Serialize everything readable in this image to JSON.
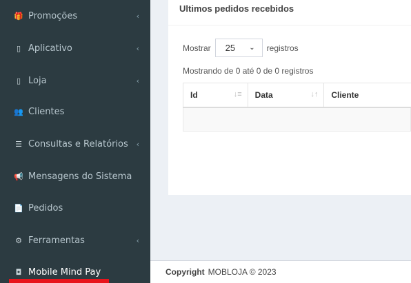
{
  "sidebar": {
    "items": [
      {
        "label": "Promoções",
        "icon": "gift-icon",
        "glyph": "🎁",
        "chevron": "‹"
      },
      {
        "label": "Aplicativo",
        "icon": "mobile-icon",
        "glyph": "▯",
        "chevron": "‹"
      },
      {
        "label": "Loja",
        "icon": "store-icon",
        "glyph": "▯",
        "chevron": "‹"
      },
      {
        "label": "Clientes",
        "icon": "users-icon",
        "glyph": "👥",
        "chevron": ""
      },
      {
        "label": "Consultas e Relatórios",
        "icon": "list-icon",
        "glyph": "☰",
        "chevron": "‹"
      },
      {
        "label": "Mensagens do Sistema",
        "icon": "bullhorn-icon",
        "glyph": "📢",
        "chevron": ""
      },
      {
        "label": "Pedidos",
        "icon": "file-icon",
        "glyph": "📄",
        "chevron": ""
      },
      {
        "label": "Ferramentas",
        "icon": "cogs-icon",
        "glyph": "⚙",
        "chevron": "‹"
      },
      {
        "label": "Mobile Mind Pay",
        "icon": "money-icon",
        "glyph": "◘",
        "chevron": ""
      }
    ],
    "active_accent": "#e8141c"
  },
  "orders_box": {
    "title": "Ultimos pedidos recebidos",
    "show_label": "Mostrar",
    "page_size": "25",
    "records_label": "registros",
    "info_text": "Mostrando de 0 até 0 de 0 registros",
    "columns": [
      "Id",
      "Data",
      "Cliente"
    ],
    "rows": []
  },
  "footer": {
    "copyright_label": "Copyright",
    "copyright_text": "MOBLOJA © 2023"
  }
}
